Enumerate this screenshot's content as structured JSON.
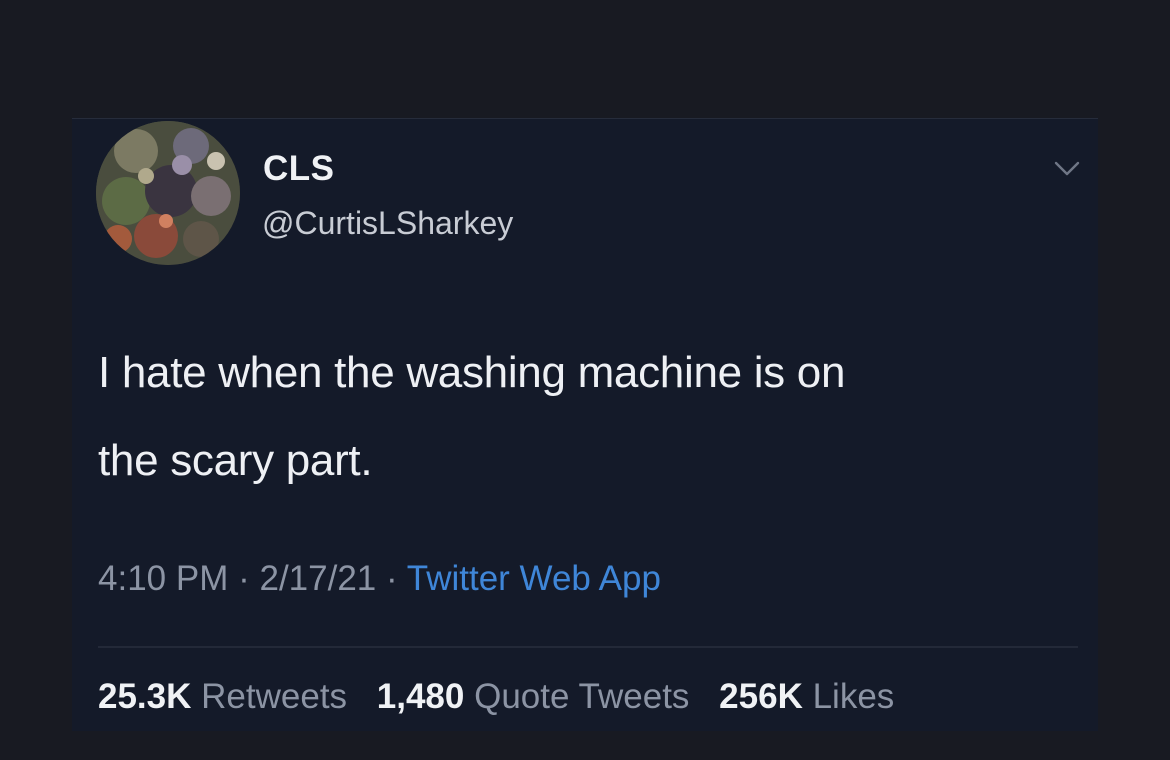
{
  "tweet": {
    "display_name": "CLS",
    "handle": "@CurtisLSharkey",
    "text_line1": "I hate when the washing machine is on",
    "text_line2": "the scary part.",
    "time": "4:10 PM",
    "separator": "·",
    "date": "2/17/21",
    "source": "Twitter Web App",
    "stats": {
      "retweets_count": "25.3K",
      "retweets_label": "Retweets",
      "quotes_count": "1,480",
      "quotes_label": "Quote Tweets",
      "likes_count": "256K",
      "likes_label": "Likes"
    }
  },
  "icons": {
    "caret": "chevron-down-icon"
  },
  "colors": {
    "background": "#181a22",
    "card": "#141a29",
    "text": "#eef0f4",
    "muted": "#8c94a4",
    "link": "#3f86d8"
  }
}
